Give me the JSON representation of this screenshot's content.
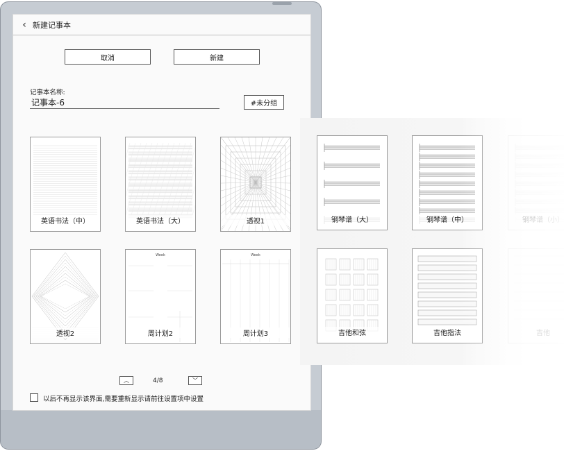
{
  "header": {
    "back_icon": "chevron-left-icon",
    "back_glyph": "‹",
    "title": "新建记事本"
  },
  "actions": {
    "cancel_label": "取消",
    "create_label": "新建"
  },
  "form": {
    "name_label": "记事本名称:",
    "name_value": "记事本-6",
    "group_label": "#未分组"
  },
  "templates": [
    {
      "label": "英语书法（中）",
      "kind": "lines-fine"
    },
    {
      "label": "英语书法（大）",
      "kind": "lines-slant"
    },
    {
      "label": "透视1",
      "kind": "perspective"
    },
    {
      "label": "钢琴谱（大）",
      "kind": "piano-big"
    },
    {
      "label": "钢琴谱（中）",
      "kind": "piano-mid"
    },
    {
      "label": "钢琴谱（小）",
      "kind": "piano-small"
    },
    {
      "label": "透视2",
      "kind": "diamond"
    },
    {
      "label": "周计划2",
      "kind": "week2"
    },
    {
      "label": "周计划3",
      "kind": "week3"
    },
    {
      "label": "吉他和弦",
      "kind": "guitar-chord"
    },
    {
      "label": "吉他指法",
      "kind": "guitar-tab"
    },
    {
      "label": "吉他",
      "kind": "blank-faded"
    }
  ],
  "week_label": "Week",
  "pager": {
    "up_glyph": "︿",
    "down_glyph": "﹀",
    "page_text": "4/8"
  },
  "footer": {
    "checkbox_label": "以后不再显示该界面,需要重新显示请前往设置项中设置",
    "checked": false
  }
}
